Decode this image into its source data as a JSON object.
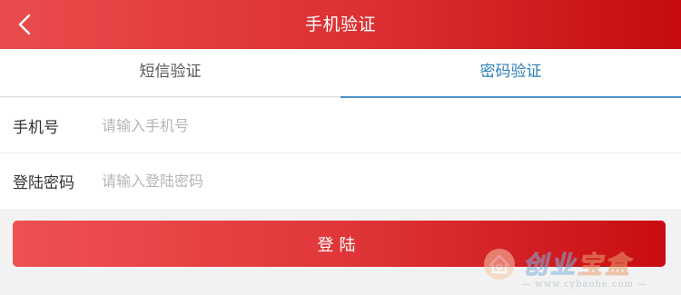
{
  "header": {
    "title": "手机验证",
    "back_icon": "chevron-left-icon"
  },
  "tabs": [
    {
      "label": "短信验证",
      "active": false
    },
    {
      "label": "密码验证",
      "active": true
    }
  ],
  "form": {
    "phone": {
      "label": "手机号",
      "placeholder": "请输入手机号",
      "value": ""
    },
    "password": {
      "label": "登陆密码",
      "placeholder": "请输入登陆密码",
      "value": ""
    }
  },
  "login_button": {
    "label": "登陆"
  },
  "watermark": {
    "brand_prefix": "创业",
    "brand_suffix": "宝盒",
    "url": "— www.cybaohe.com —"
  },
  "colors": {
    "header_gradient_start": "#ea4c4d",
    "header_gradient_end": "#c50b10",
    "active_tab": "#2e7fb8",
    "button_gradient_start": "#ee5152",
    "button_gradient_end": "#c80d12"
  }
}
